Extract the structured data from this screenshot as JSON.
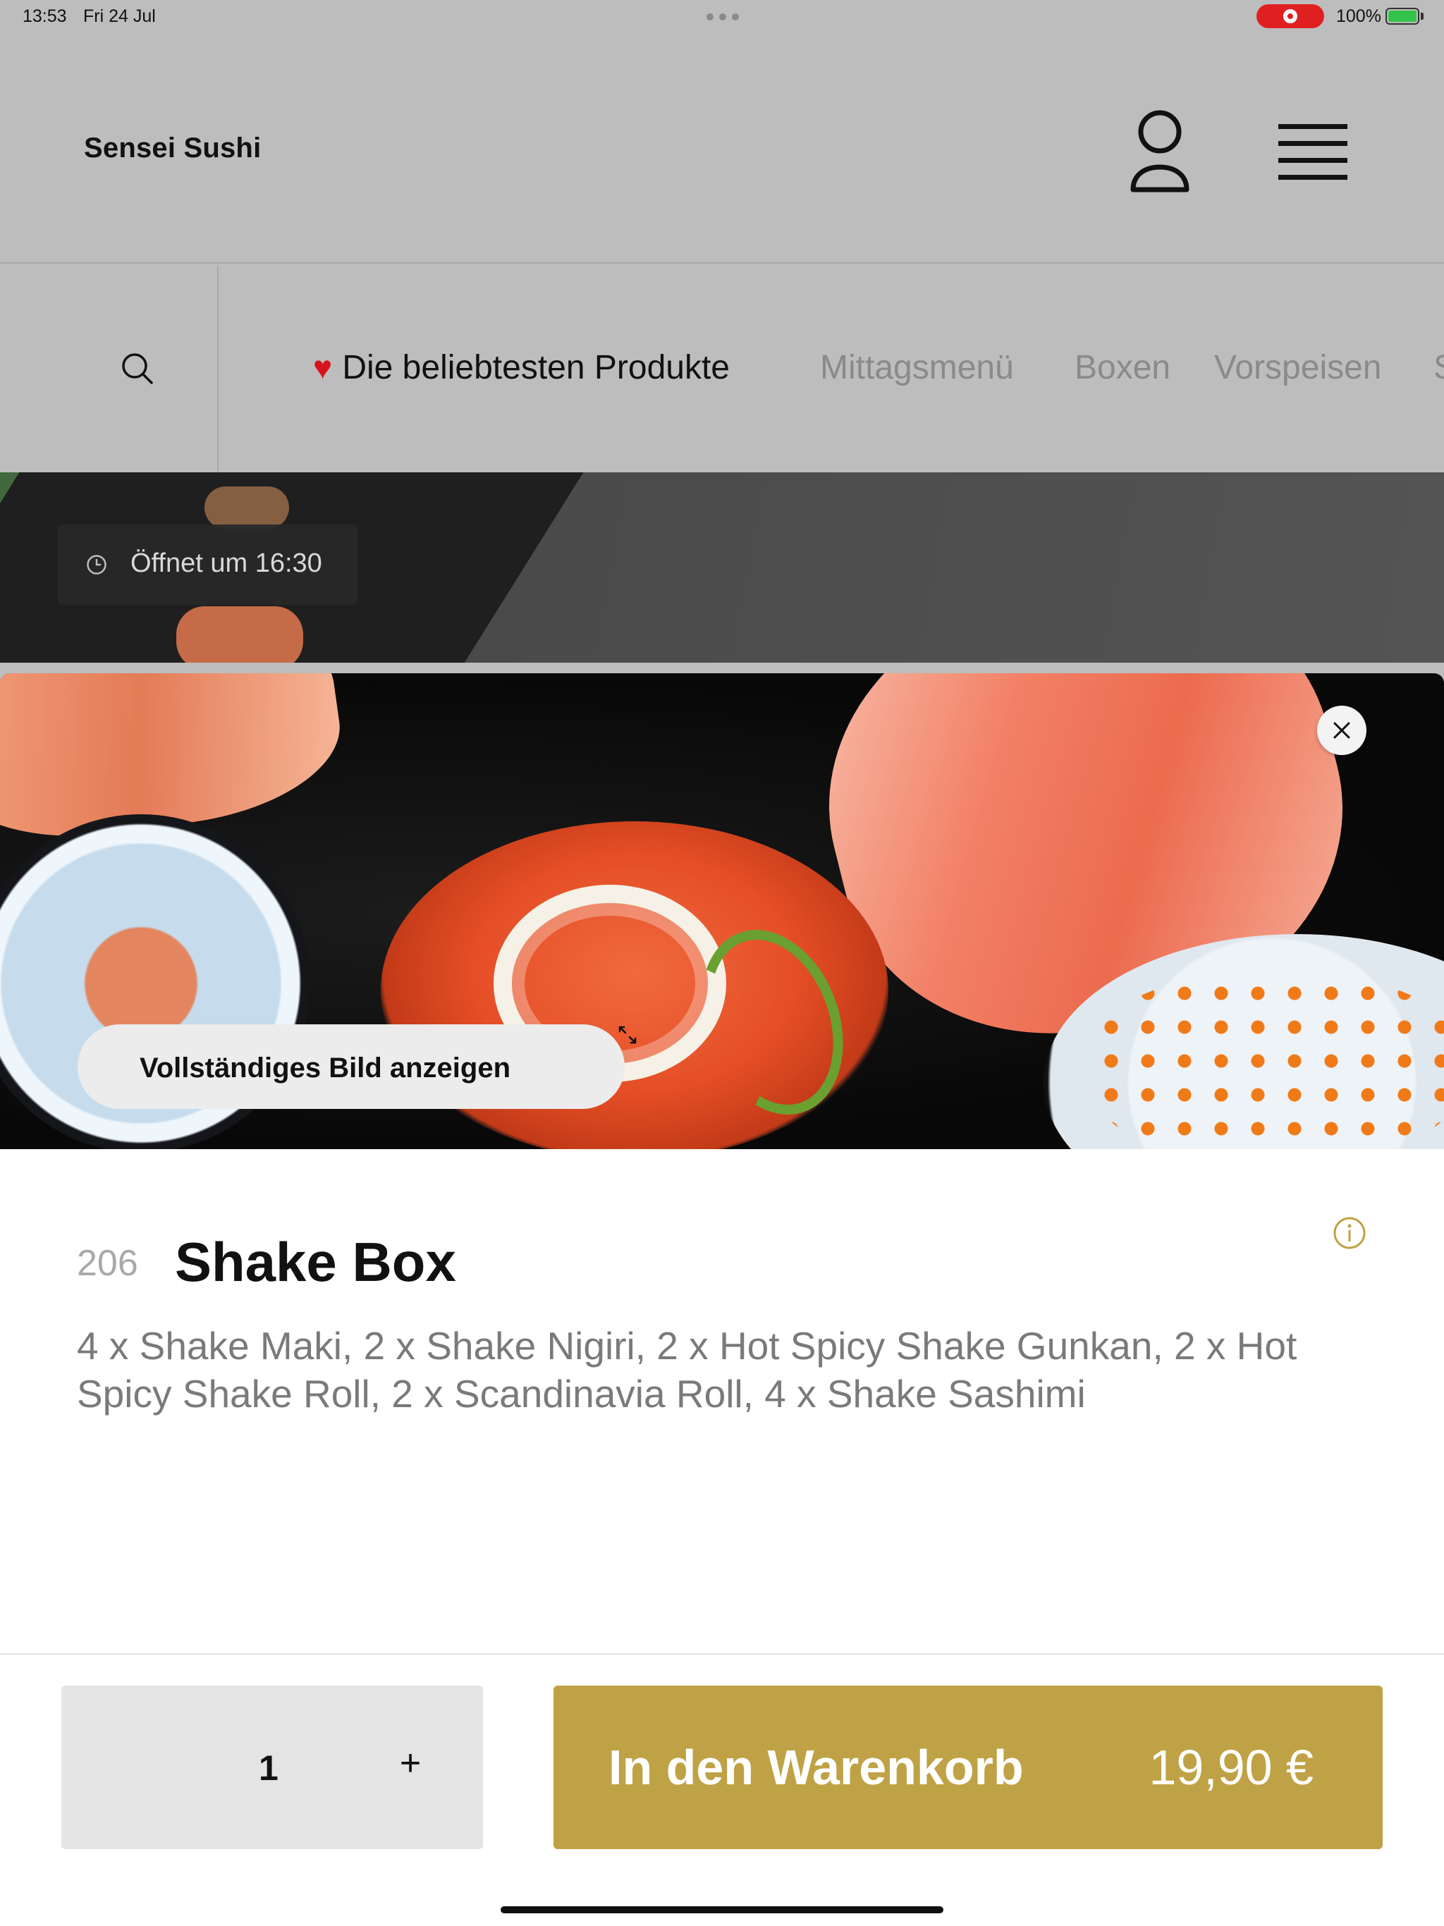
{
  "status_bar": {
    "time": "13:53",
    "date": "Fri 24 Jul",
    "battery_percent": "100%"
  },
  "header": {
    "brand": "Sensei Sushi",
    "icons": {
      "account": "user-icon",
      "menu": "hamburger-menu-icon"
    }
  },
  "categories": {
    "search_icon": "search-icon",
    "tabs": [
      {
        "label": "Die beliebtesten Produkte",
        "icon": "heart-icon",
        "active": true
      },
      {
        "label": "Mittagsmenü",
        "active": false
      },
      {
        "label": "Boxen",
        "active": false
      },
      {
        "label": "Vorspeisen",
        "active": false
      },
      {
        "label": "S",
        "active": false
      }
    ]
  },
  "banner": {
    "opening_text": "Öffnet um 16:30",
    "icon": "clock-icon"
  },
  "product": {
    "full_image_label": "Vollständiges Bild anzeigen",
    "number": "206",
    "title": "Shake Box",
    "description": "4 x Shake Maki, 2 x Shake Nigiri, 2 x Hot Spicy Shake Gunkan, 2 x Hot Spicy Shake Roll, 2 x Scandinavia Roll, 4 x Shake Sashimi",
    "quantity": "1",
    "plus_label": "+",
    "add_to_cart_label": "In den Warenkorb",
    "price": "19,90 €"
  },
  "colors": {
    "accent": "#bfa245",
    "overlay_background": "#bdbdbd",
    "heart": "#d6141d"
  }
}
